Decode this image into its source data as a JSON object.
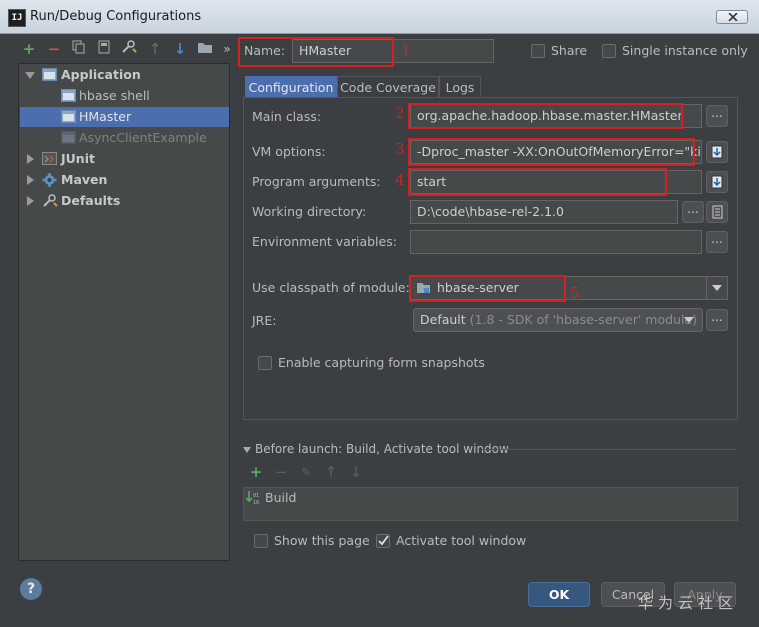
{
  "window": {
    "title": "Run/Debug Configurations",
    "icon_text": "IJ"
  },
  "tree": {
    "application": "Application",
    "hbase_shell": "hbase shell",
    "hmaster": "HMaster",
    "async_client": "AsyncClientExample",
    "junit": "JUnit",
    "maven": "Maven",
    "defaults": "Defaults"
  },
  "name_field": {
    "label": "Name:",
    "value": "HMaster"
  },
  "share": {
    "label": "Share",
    "checked": false
  },
  "single_instance": {
    "label": "Single instance only",
    "checked": false
  },
  "tabs": [
    "Configuration",
    "Code Coverage",
    "Logs"
  ],
  "form": {
    "main_class": {
      "label": "Main class:",
      "value": "org.apache.hadoop.hbase.master.HMaster"
    },
    "vm_options": {
      "label": "VM options:",
      "value": "-Dproc_master -XX:OnOutOfMemoryError=\"kill"
    },
    "program_args": {
      "label": "Program arguments:",
      "value": "start"
    },
    "working_dir": {
      "label": "Working directory:",
      "value": "D:\\code\\hbase-rel-2.1.0"
    },
    "env_vars": {
      "label": "Environment variables:",
      "value": ""
    },
    "classpath": {
      "label": "Use classpath of module:",
      "value": "hbase-server"
    },
    "jre": {
      "label": "JRE:",
      "value": "Default",
      "hint": "(1.8 - SDK of 'hbase-server' module)"
    },
    "snapshots": {
      "label": "Enable capturing form snapshots",
      "checked": false
    }
  },
  "before_launch": {
    "label": "Before launch: Build, Activate tool window",
    "task": "Build"
  },
  "show_page": {
    "label": "Show this page",
    "checked": false
  },
  "activate_tool": {
    "label": "Activate tool window",
    "checked": true
  },
  "buttons": {
    "ok": "OK",
    "cancel": "Cancel",
    "apply": "Apply",
    "help": "?"
  },
  "annotations": [
    "1",
    "2",
    "3",
    "4",
    "5"
  ],
  "watermark": "华为云社区",
  "colors": {
    "accent": "#4b6eaf",
    "annotation_red": "#d62020",
    "add_green": "#59a869"
  }
}
